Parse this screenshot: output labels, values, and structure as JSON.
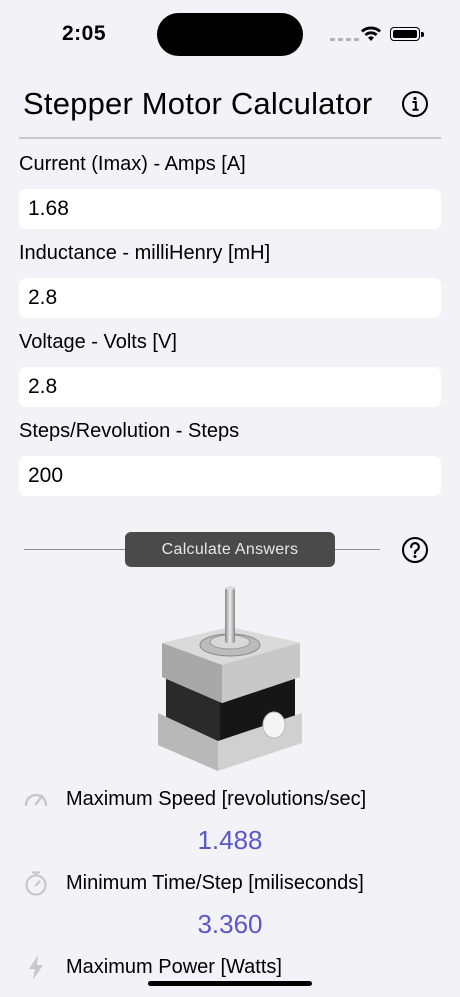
{
  "status_bar": {
    "time": "2:05"
  },
  "header": {
    "title": "Stepper Motor Calculator"
  },
  "fields": [
    {
      "label": "Current (Imax) - Amps [A]",
      "value": "1.68"
    },
    {
      "label": "Inductance - milliHenry [mH]",
      "value": "2.8"
    },
    {
      "label": "Voltage - Volts [V]",
      "value": "2.8"
    },
    {
      "label": "Steps/Revolution - Steps",
      "value": "200"
    }
  ],
  "calculate_label": "Calculate Answers",
  "results": [
    {
      "label": "Maximum Speed [revolutions/sec]",
      "value": "1.488",
      "icon": "speedometer-icon"
    },
    {
      "label": "Minimum Time/Step [miliseconds]",
      "value": "3.360",
      "icon": "stopwatch-icon"
    },
    {
      "label": "Maximum Power [Watts]",
      "value": "",
      "icon": "bolt-icon"
    }
  ],
  "colors": {
    "result_value": "#5a58c8",
    "background": "#f2f2f7",
    "button": "#4a4a4a"
  }
}
